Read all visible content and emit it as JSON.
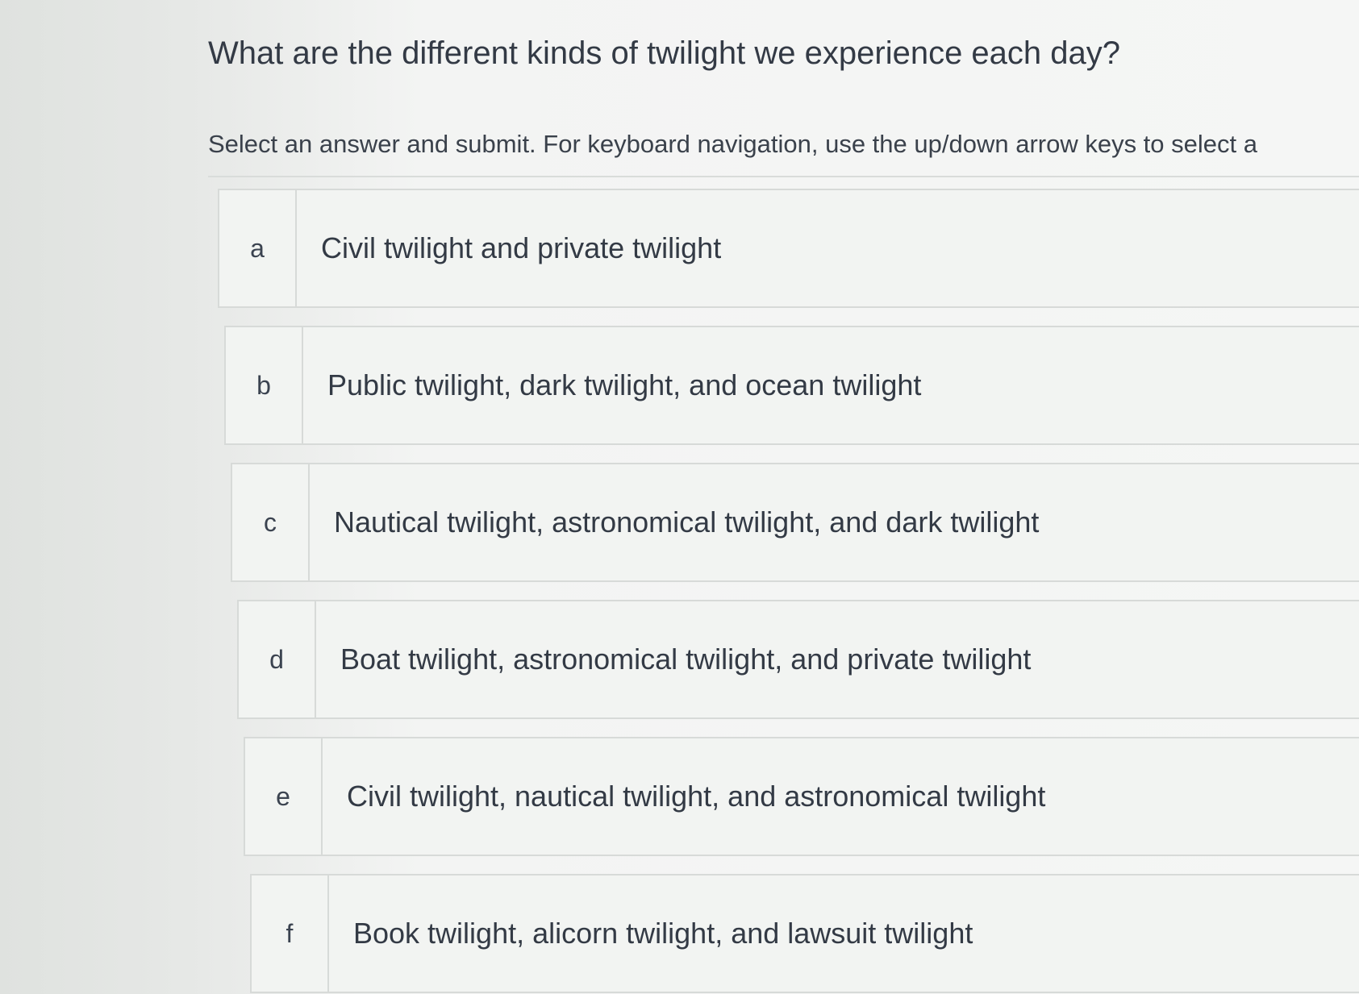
{
  "question": {
    "text": "What are the different kinds of twilight we experience each day?"
  },
  "instructions": {
    "text": "Select an answer and submit. For keyboard navigation, use the up/down arrow keys to select a"
  },
  "options": [
    {
      "letter": "a",
      "text": "Civil twilight and private twilight"
    },
    {
      "letter": "b",
      "text": "Public twilight, dark twilight, and ocean twilight"
    },
    {
      "letter": "c",
      "text": "Nautical twilight, astronomical twilight, and dark twilight"
    },
    {
      "letter": "d",
      "text": "Boat twilight, astronomical twilight, and private twilight"
    },
    {
      "letter": "e",
      "text": "Civil twilight, nautical twilight, and astronomical twilight"
    },
    {
      "letter": "f",
      "text": "Book twilight, alicorn twilight, and lawsuit twilight"
    }
  ]
}
